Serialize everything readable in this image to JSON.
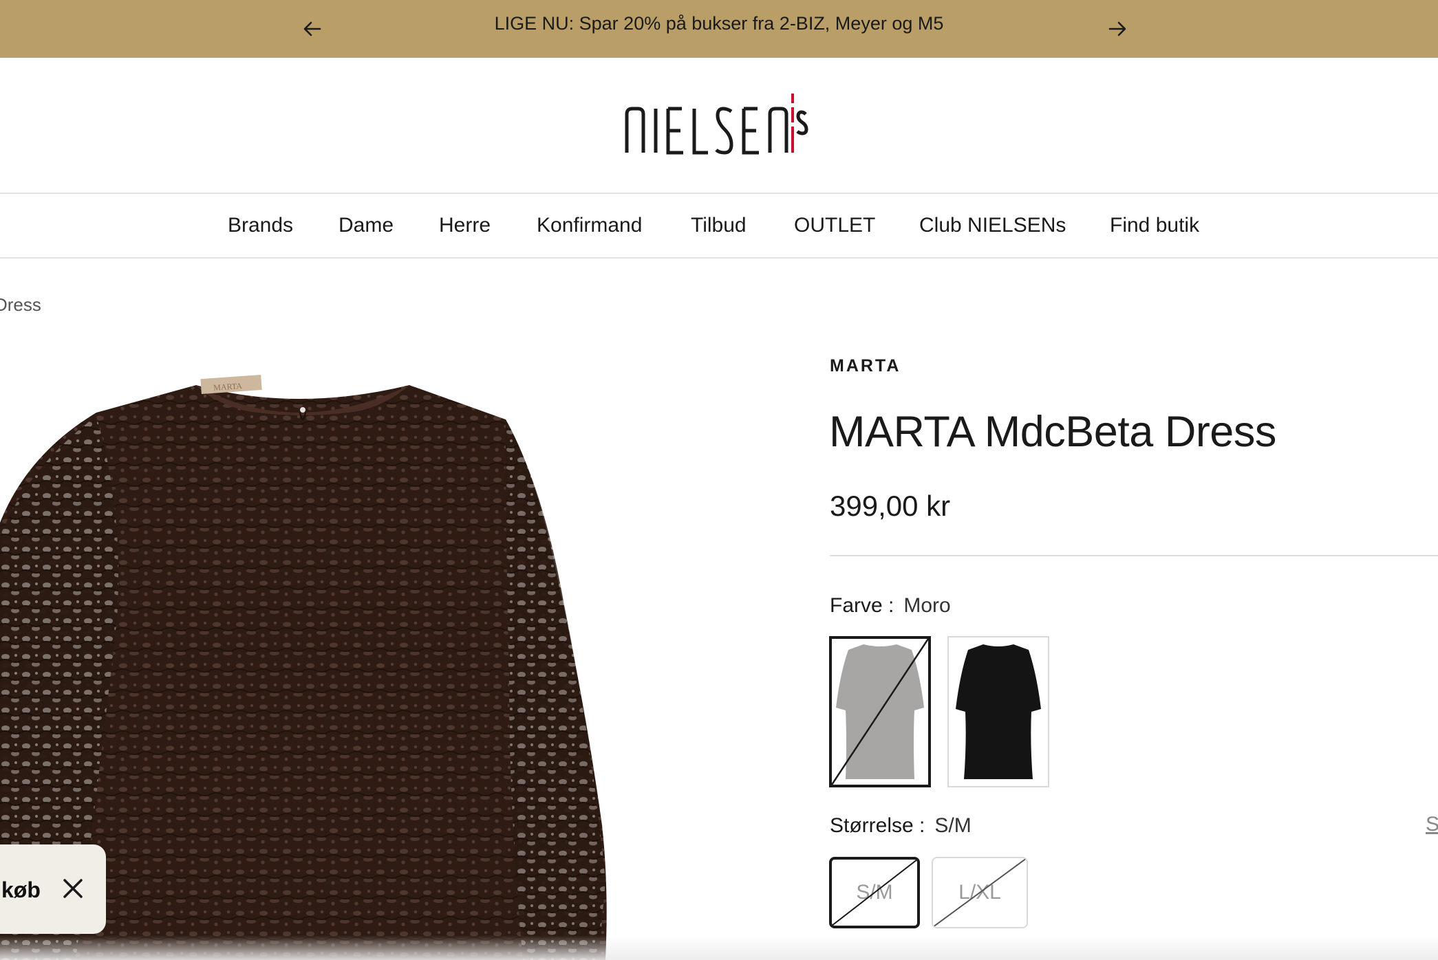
{
  "announcement": {
    "text": "LIGE NU: Spar 20% på bukser fra 2-BIZ, Meyer og M5",
    "prev_icon": "arrow-left-icon",
    "next_icon": "arrow-right-icon",
    "background": "#b99e67"
  },
  "logo": {
    "text": "NIELSEN's",
    "accent_color": "#c8102e"
  },
  "nav": {
    "items": [
      "Brands",
      "Dame",
      "Herre",
      "Konfirmand",
      "Tilbud",
      "OUTLET",
      "Club NIELSENs",
      "Find butik"
    ]
  },
  "breadcrumb": {
    "current": "Dress"
  },
  "product": {
    "brand": "MARTA",
    "title": "MARTA MdcBeta Dress",
    "price": "399,00 kr",
    "image_label": "MARTA",
    "color": {
      "label": "Farve :",
      "value": "Moro",
      "swatches": [
        {
          "name": "Moro",
          "selected": true,
          "unavailable": true,
          "color": "#5a3c2e"
        },
        {
          "name": "Black",
          "selected": false,
          "unavailable": false,
          "color": "#111111"
        }
      ]
    },
    "size": {
      "label": "Størrelse :",
      "value": "S/M",
      "options": [
        {
          "label": "S/M",
          "selected": true,
          "unavailable": true
        },
        {
          "label": "L/XL",
          "selected": false,
          "unavailable": true
        }
      ],
      "guide_label": "S"
    }
  },
  "popup": {
    "label": "køb",
    "close_icon": "close-icon"
  }
}
